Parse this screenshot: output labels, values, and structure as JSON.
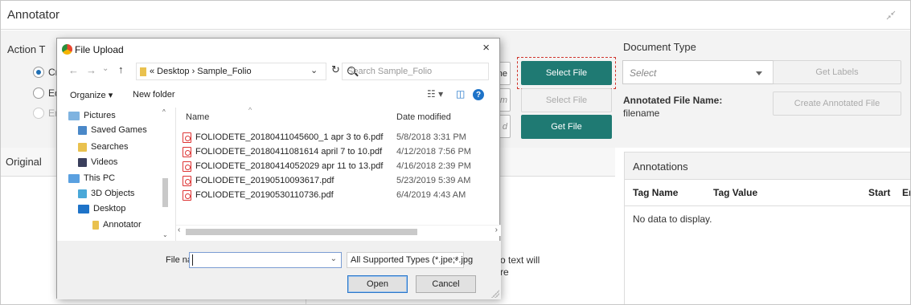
{
  "app": {
    "title": "Annotator"
  },
  "action": {
    "label_visible": "Action T",
    "options": [
      {
        "visible_text": "Cr",
        "state": "checked"
      },
      {
        "visible_text": "Ed",
        "state": "normal"
      },
      {
        "visible_text": "Er",
        "state": "disabled"
      }
    ]
  },
  "partial_buttons": {
    "top": "ne",
    "middle": "am",
    "bottom": "d"
  },
  "buttons": {
    "select_file_primary": "Select File",
    "select_file_secondary": "Select File",
    "get_file": "Get File",
    "get_labels": "Get Labels",
    "create_annotated_file": "Create Annotated File"
  },
  "document_type": {
    "label": "Document Type",
    "selected": "Select"
  },
  "annotated_file": {
    "label": "Annotated File Name:",
    "value": "filename"
  },
  "original_panel": {
    "title": "Original"
  },
  "middle_panel": {
    "text_line1": "o text will",
    "text_line2": "re"
  },
  "annotations": {
    "title": "Annotations",
    "columns": [
      "Tag Name",
      "Tag Value",
      "Start",
      "End"
    ],
    "empty_text": "No data to display."
  },
  "dialog": {
    "title": "File Upload",
    "close_glyph": "×",
    "address_path": "« Desktop  ›  Sample_Folio",
    "search_placeholder": "Search Sample_Folio",
    "toolbar": {
      "organize": "Organize ▾",
      "new_folder": "New folder"
    },
    "nav_items": [
      "Pictures",
      "Saved Games",
      "Searches",
      "Videos",
      "This PC",
      "3D Objects",
      "Desktop",
      "Annotator"
    ],
    "columns": {
      "name": "Name",
      "date": "Date modified"
    },
    "files": [
      {
        "name": "FOLIODETE_20180411045600_1 apr 3 to 6.pdf",
        "date": "5/8/2018 3:31 PM"
      },
      {
        "name": "FOLIODETE_20180411081614 april 7 to 10.pdf",
        "date": "4/12/2018 7:56 PM"
      },
      {
        "name": "FOLIODETE_20180414052029 apr 11 to 13.pdf",
        "date": "4/16/2018 2:39 PM"
      },
      {
        "name": "FOLIODETE_20190510093617.pdf",
        "date": "5/23/2019 5:39 AM"
      },
      {
        "name": "FOLIODETE_20190530110736.pdf",
        "date": "6/4/2019 4:43 AM"
      }
    ],
    "file_name_label": "File name:",
    "file_name_value": "",
    "file_type": "All Supported Types (*.jpe;*.jpg",
    "open_label": "Open",
    "cancel_label": "Cancel"
  },
  "colors": {
    "accent_teal": "#1f7a73",
    "focus_red": "#d0342c",
    "link_blue": "#1e73c8"
  }
}
